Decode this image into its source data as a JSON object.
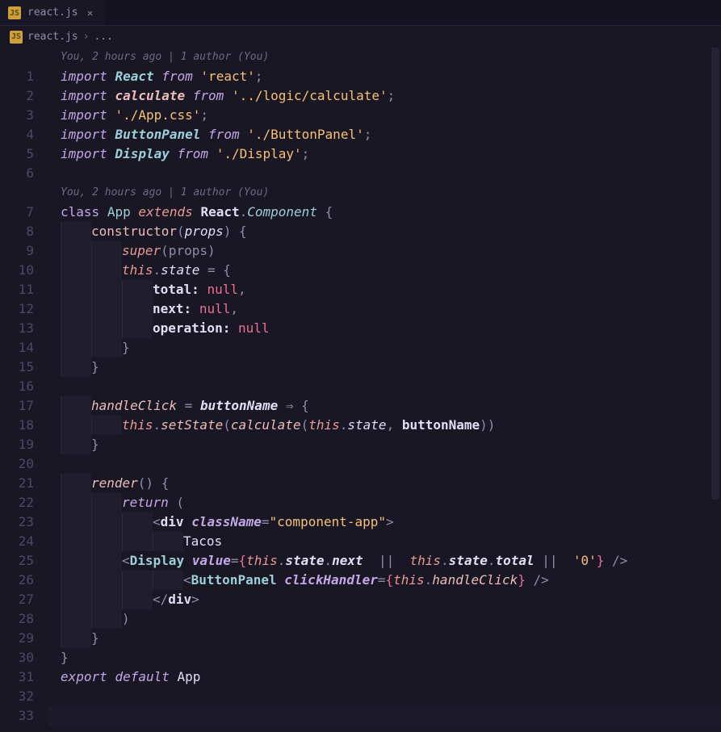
{
  "tab": {
    "filename": "react.js"
  },
  "breadcrumb": {
    "filename": "react.js",
    "rest": "..."
  },
  "codelens": "You, 2 hours ago | 1 author (You)",
  "lineStart": 1,
  "lineEnd": 33,
  "code": {
    "l1": {
      "import": "import",
      "React": "React",
      "from": "from",
      "str": "'react'",
      "semi": ";"
    },
    "l2": {
      "import": "import",
      "calculate": "calculate",
      "from": "from",
      "str": "'../logic/calculate'",
      "semi": ";"
    },
    "l3": {
      "import": "import",
      "str": "'./App.css'",
      "semi": ";"
    },
    "l4": {
      "import": "import",
      "ButtonPanel": "ButtonPanel",
      "from": "from",
      "str": "'./ButtonPanel'",
      "semi": ";"
    },
    "l5": {
      "import": "import",
      "Display": "Display",
      "from": "from",
      "str": "'./Display'",
      "semi": ";"
    },
    "l7": {
      "class": "class",
      "App": "App",
      "extends": "extends",
      "React": "React",
      "dot": ".",
      "Component": "Component",
      "open": " {"
    },
    "l8": {
      "constructor": "constructor",
      "open": "(",
      "props": "props",
      "close": ") {"
    },
    "l9": {
      "super": "super",
      "open": "(props)"
    },
    "l10": {
      "this": "this",
      "dot": ".",
      "state": "state",
      "eq": " = {"
    },
    "l11": {
      "key": "total:",
      "sp": " ",
      "null": "null",
      "comma": ","
    },
    "l12": {
      "key": "next:",
      "sp": " ",
      "null": "null",
      "comma": ","
    },
    "l13": {
      "key": "operation:",
      "sp": " ",
      "null": "null"
    },
    "l14": {
      "close": "}"
    },
    "l15": {
      "close": "}"
    },
    "l17": {
      "handleClick": "handleClick",
      "eq": " = ",
      "buttonName": "buttonName",
      "arrow": " ⇒ {"
    },
    "l18": {
      "this": "this",
      "dot1": ".",
      "setState": "setState",
      "open": "(",
      "calculate": "calculate",
      "open2": "(",
      "this2": "this",
      "dot2": ".",
      "state": "state",
      "comma": ", ",
      "buttonName": "buttonName",
      "close": "))"
    },
    "l19": {
      "close": "}"
    },
    "l21": {
      "render": "render",
      "paren": "() {"
    },
    "l22": {
      "return": "return",
      "open": " ("
    },
    "l23": {
      "open": "<",
      "div": "div",
      "sp": " ",
      "className": "className",
      "eq": "=",
      "str": "\"component-app\"",
      "close": ">"
    },
    "l24": {
      "text": "Tacos"
    },
    "l25": {
      "open": "<",
      "Display": "Display",
      "sp": " ",
      "value": "value",
      "eq": "=",
      "bopen": "{",
      "this": "this",
      "d1": ".",
      "state": "state",
      "d2": ".",
      "next": "next",
      "or1": "  || ",
      "this2": "this",
      "d3": ".",
      "state2": "state",
      "d4": ".",
      "total": "total",
      "or2": " || ",
      "zero": "'0'",
      "bclose": "}",
      "slash": " />"
    },
    "l26": {
      "open": "<",
      "ButtonPanel": "ButtonPanel",
      "sp": " ",
      "clickHandler": "clickHandler",
      "eq": "=",
      "bopen": "{",
      "this": "this",
      "d1": ".",
      "handleClick": "handleClick",
      "bclose": "}",
      "slash": " />"
    },
    "l27": {
      "close": "</",
      "div": "div",
      "gt": ">"
    },
    "l28": {
      "close": ")"
    },
    "l29": {
      "close": "}"
    },
    "l30": {
      "close": "}"
    },
    "l31": {
      "export": "export",
      "default": "default",
      "App": " App"
    }
  }
}
